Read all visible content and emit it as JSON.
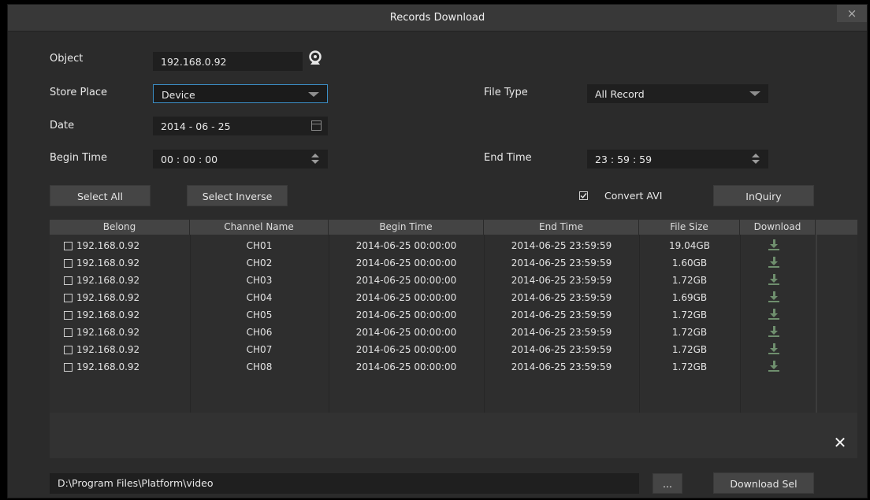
{
  "window": {
    "title": "Records Download",
    "close_label": "×"
  },
  "form": {
    "object_label": "Object",
    "object_value": "192.168.0.92",
    "store_place_label": "Store Place",
    "store_place_value": "Device",
    "file_type_label": "File Type",
    "file_type_value": "All Record",
    "date_label": "Date",
    "date_value": "2014 - 06 - 25",
    "begin_time_label": "Begin Time",
    "begin_time_value": "00 : 00 : 00",
    "end_time_label": "End Time",
    "end_time_value": "23 : 59 : 59"
  },
  "buttons": {
    "select_all": "Select All",
    "select_inverse": "Select Inverse",
    "convert_avi": "Convert AVI",
    "inquiry": "InQuiry",
    "browse": "...",
    "download_sel": "Download Sel"
  },
  "table": {
    "columns": [
      "Belong",
      "Channel Name",
      "Begin Time",
      "End Time",
      "File Size",
      "Download"
    ],
    "rows": [
      {
        "belong": "192.168.0.92",
        "channel": "CH01",
        "begin": "2014-06-25 00:00:00",
        "end": "2014-06-25 23:59:59",
        "size": "19.04GB"
      },
      {
        "belong": "192.168.0.92",
        "channel": "CH02",
        "begin": "2014-06-25 00:00:00",
        "end": "2014-06-25 23:59:59",
        "size": "1.60GB"
      },
      {
        "belong": "192.168.0.92",
        "channel": "CH03",
        "begin": "2014-06-25 00:00:00",
        "end": "2014-06-25 23:59:59",
        "size": "1.72GB"
      },
      {
        "belong": "192.168.0.92",
        "channel": "CH04",
        "begin": "2014-06-25 00:00:00",
        "end": "2014-06-25 23:59:59",
        "size": "1.69GB"
      },
      {
        "belong": "192.168.0.92",
        "channel": "CH05",
        "begin": "2014-06-25 00:00:00",
        "end": "2014-06-25 23:59:59",
        "size": "1.72GB"
      },
      {
        "belong": "192.168.0.92",
        "channel": "CH06",
        "begin": "2014-06-25 00:00:00",
        "end": "2014-06-25 23:59:59",
        "size": "1.72GB"
      },
      {
        "belong": "192.168.0.92",
        "channel": "CH07",
        "begin": "2014-06-25 00:00:00",
        "end": "2014-06-25 23:59:59",
        "size": "1.72GB"
      },
      {
        "belong": "192.168.0.92",
        "channel": "CH08",
        "begin": "2014-06-25 00:00:00",
        "end": "2014-06-25 23:59:59",
        "size": "1.72GB"
      }
    ]
  },
  "path": {
    "value": "D:\\Program Files\\Platform\\video"
  },
  "icons": {
    "camera": "camera-icon",
    "dropdown": "chevron-down-icon",
    "calendar": "calendar-icon",
    "spinner": "spinner-icon",
    "download": "download-icon",
    "clear": "close-icon"
  }
}
